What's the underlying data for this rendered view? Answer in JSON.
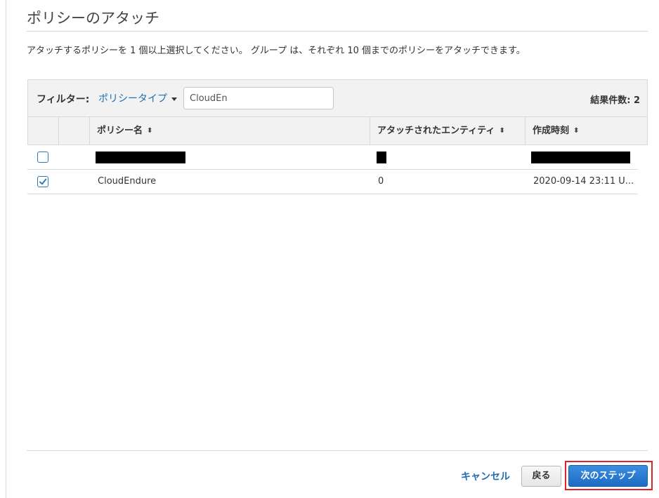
{
  "page": {
    "title": "ポリシーのアタッチ",
    "description": "アタッチするポリシーを 1 個以上選択してください。 グループ は、それぞれ 10 個までのポリシーをアタッチできます。"
  },
  "filter": {
    "label": "フィルター:",
    "policy_type": "ポリシータイプ",
    "search_value": "CloudEn",
    "result_count": "結果件数: 2"
  },
  "table": {
    "columns": [
      "ポリシー名",
      "アタッチされたエンティティ",
      "作成時刻"
    ],
    "rows": [
      {
        "checked": false,
        "name": "",
        "entities": "",
        "created": ""
      },
      {
        "checked": true,
        "name": "CloudEndure",
        "entities": "0",
        "created": "2020-09-14 23:11 U..."
      }
    ]
  },
  "footer": {
    "cancel_label": "キャンセル",
    "back_label": "戻る",
    "next_label": "次のステップ"
  },
  "colors": {
    "accent": "#1f6fb5",
    "primary_button": "#1e6bc4",
    "highlight": "#e0202a"
  }
}
